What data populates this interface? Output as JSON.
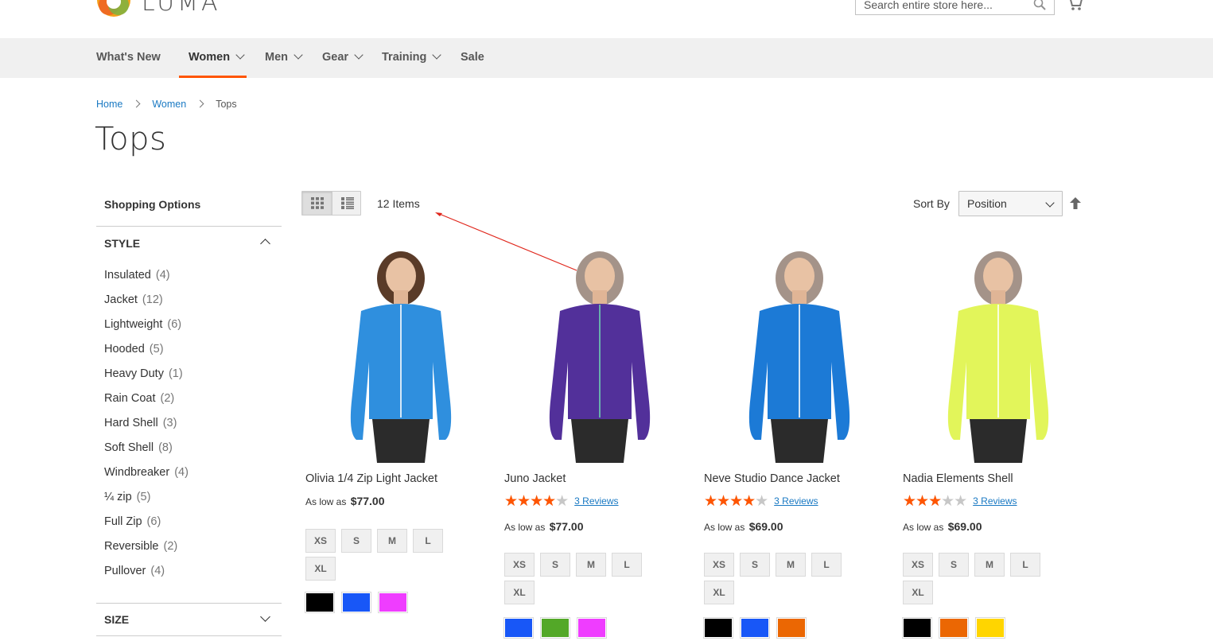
{
  "header": {
    "logo_text": "LUMA",
    "search_placeholder": "Search entire store here..."
  },
  "nav": {
    "items": [
      {
        "label": "What's New"
      },
      {
        "label": "Women"
      },
      {
        "label": "Men"
      },
      {
        "label": "Gear"
      },
      {
        "label": "Training"
      },
      {
        "label": "Sale"
      }
    ],
    "active": "Women"
  },
  "breadcrumb": {
    "home": "Home",
    "women": "Women",
    "current": "Tops"
  },
  "page_title": "Tops",
  "sidebar": {
    "title": "Shopping Options",
    "style_title": "STYLE",
    "style_items": [
      {
        "label": "Insulated",
        "count": "(4)"
      },
      {
        "label": "Jacket",
        "count": "(12)"
      },
      {
        "label": "Lightweight",
        "count": "(6)"
      },
      {
        "label": "Hooded",
        "count": "(5)"
      },
      {
        "label": "Heavy Duty",
        "count": "(1)"
      },
      {
        "label": "Rain Coat",
        "count": "(2)"
      },
      {
        "label": "Hard Shell",
        "count": "(3)"
      },
      {
        "label": "Soft Shell",
        "count": "(8)"
      },
      {
        "label": "Windbreaker",
        "count": "(4)"
      },
      {
        "label": "¼ zip",
        "count": "(5)"
      },
      {
        "label": "Full Zip",
        "count": "(6)"
      },
      {
        "label": "Reversible",
        "count": "(2)"
      },
      {
        "label": "Pullover",
        "count": "(4)"
      }
    ],
    "size_title": "SIZE"
  },
  "toolbar": {
    "items_count": "12 Items",
    "sort_label": "Sort By",
    "sort_value": "Position"
  },
  "colors": {
    "accent": "#ff5501",
    "link": "#1979c3",
    "nav_bg": "#f0f0f0"
  },
  "products": [
    {
      "name": "Olivia 1/4 Zip Light Jacket",
      "rating_fraction": null,
      "reviews": "",
      "price_prefix": "As low as",
      "price": "$77.00",
      "sizes": [
        "XS",
        "S",
        "M",
        "L",
        "XL"
      ],
      "swatches": [
        "#000000",
        "#1857f7",
        "#ef3dff"
      ],
      "garment_color": "#2f8fde"
    },
    {
      "name": "Juno Jacket",
      "rating_fraction": 0.8,
      "reviews": "3 Reviews",
      "price_prefix": "As low as",
      "price": "$77.00",
      "sizes": [
        "XS",
        "S",
        "M",
        "L",
        "XL"
      ],
      "swatches": [
        "#1857f7",
        "#53a828",
        "#ef3dff"
      ],
      "garment_color": "#52309a"
    },
    {
      "name": "Neve Studio Dance Jacket",
      "rating_fraction": 0.8,
      "reviews": "3 Reviews",
      "price_prefix": "As low as",
      "price": "$69.00",
      "sizes": [
        "XS",
        "S",
        "M",
        "L",
        "XL"
      ],
      "swatches": [
        "#000000",
        "#1857f7",
        "#eb6703"
      ],
      "garment_color": "#1c7ad6"
    },
    {
      "name": "Nadia Elements Shell",
      "rating_fraction": 0.6,
      "reviews": "3 Reviews",
      "price_prefix": "As low as",
      "price": "$69.00",
      "sizes": [
        "XS",
        "S",
        "M",
        "L",
        "XL"
      ],
      "swatches": [
        "#000000",
        "#eb6703",
        "#ffd500"
      ],
      "garment_color": "#e2f55a"
    }
  ]
}
